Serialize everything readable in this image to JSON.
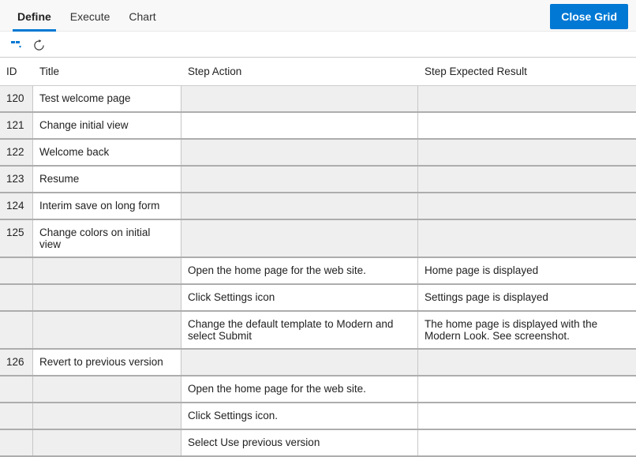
{
  "header": {
    "tabs": [
      "Define",
      "Execute",
      "Chart"
    ],
    "active_tab": 0,
    "close_label": "Close Grid"
  },
  "columns": {
    "id": "ID",
    "title": "Title",
    "action": "Step Action",
    "result": "Step Expected Result"
  },
  "rows": [
    {
      "type": "group",
      "id": "120",
      "title": "Test welcome page",
      "action": "",
      "result": ""
    },
    {
      "type": "group",
      "id": "121",
      "title": "Change initial view",
      "action": "",
      "result": ""
    },
    {
      "type": "group",
      "id": "122",
      "title": "Welcome back",
      "action": "",
      "result": ""
    },
    {
      "type": "group",
      "id": "123",
      "title": "Resume",
      "action": "",
      "result": ""
    },
    {
      "type": "group",
      "id": "124",
      "title": "Interim save on long form",
      "action": "",
      "result": ""
    },
    {
      "type": "group",
      "id": "125",
      "title": "Change colors on initial view",
      "action": "",
      "result": ""
    },
    {
      "type": "step",
      "id": "",
      "title": "",
      "action": "Open the home page for the web site.",
      "result": "Home page is displayed"
    },
    {
      "type": "step",
      "id": "",
      "title": "",
      "action": "Click Settings icon",
      "result": "Settings page is displayed"
    },
    {
      "type": "step",
      "id": "",
      "title": "",
      "action": "Change the default template to Modern and select Submit",
      "result": "The home page is displayed with the Modern Look. See screenshot."
    },
    {
      "type": "group",
      "id": "126",
      "title": "Revert to previous version",
      "action": "",
      "result": ""
    },
    {
      "type": "step",
      "id": "",
      "title": "",
      "action": "Open the home page for the web site.",
      "result": ""
    },
    {
      "type": "step",
      "id": "",
      "title": "",
      "action": "Click Settings icon.",
      "result": ""
    },
    {
      "type": "step",
      "id": "",
      "title": "",
      "action": "Select Use previous version",
      "result": ""
    }
  ]
}
